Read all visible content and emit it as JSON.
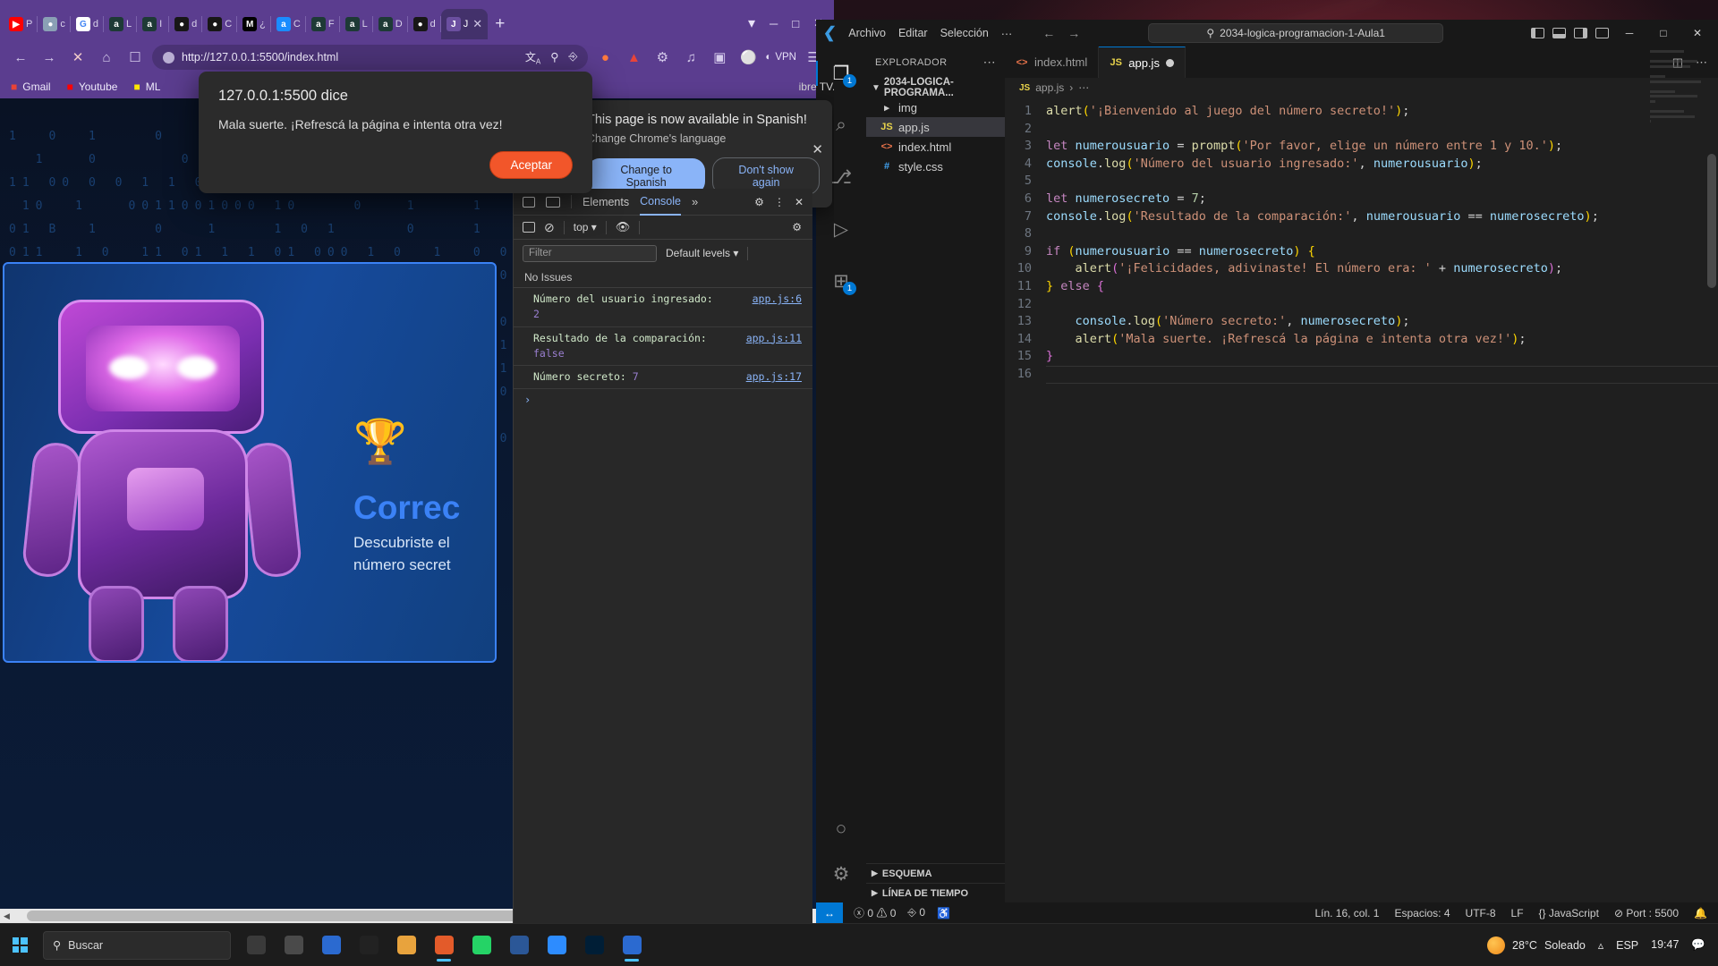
{
  "desktop": {
    "taskbar": {
      "search_placeholder": "Buscar",
      "weather_temp": "28°C",
      "weather_cond": "Soleado",
      "language": "ESP",
      "clock": "19:47",
      "start_icon": "windows-logo-icon",
      "apps": [
        {
          "name": "task-view-icon",
          "color": "#3a3a3a"
        },
        {
          "name": "settings-icon",
          "color": "#4a4a4a"
        },
        {
          "name": "store-icon",
          "color": "#2b6ad0"
        },
        {
          "name": "terminal-icon",
          "color": "#222"
        },
        {
          "name": "explorer-icon",
          "color": "#e8a33d"
        },
        {
          "name": "firefox-icon",
          "color": "#e35b2a"
        },
        {
          "name": "whatsapp-icon",
          "color": "#25d366"
        },
        {
          "name": "word-icon",
          "color": "#2b5797"
        },
        {
          "name": "zoom-icon",
          "color": "#2d8cff"
        },
        {
          "name": "photoshop-icon",
          "color": "#001e36"
        },
        {
          "name": "vscode-icon",
          "color": "#2b6ad0"
        }
      ]
    }
  },
  "chrome": {
    "tabs": [
      {
        "label": "P",
        "fav": "youtube-icon",
        "color": "#ff0000",
        "glyph": "▶",
        "active": false
      },
      {
        "label": "c",
        "fav": "globe-icon",
        "color": "#8aa0b5",
        "glyph": "●",
        "active": false
      },
      {
        "label": "d",
        "fav": "google-icon",
        "color": "#ffffff",
        "glyph": "G",
        "active": false
      },
      {
        "label": "L",
        "fav": "alura-icon",
        "color": "#1e3a36",
        "glyph": "a",
        "active": false
      },
      {
        "label": "I",
        "fav": "alura-icon",
        "color": "#1e3a36",
        "glyph": "a",
        "active": false
      },
      {
        "label": "d",
        "fav": "github-icon",
        "color": "#181717",
        "glyph": "●",
        "active": false
      },
      {
        "label": "C",
        "fav": "github-icon",
        "color": "#181717",
        "glyph": "●",
        "active": false
      },
      {
        "label": "¿",
        "fav": "medium-icon",
        "color": "#000000",
        "glyph": "M",
        "active": false
      },
      {
        "label": "C",
        "fav": "alura-icon",
        "color": "#1a8cff",
        "glyph": "a",
        "active": false
      },
      {
        "label": "F",
        "fav": "alura-icon",
        "color": "#1e3a36",
        "glyph": "a",
        "active": false
      },
      {
        "label": "L",
        "fav": "alura-icon",
        "color": "#1e3a36",
        "glyph": "a",
        "active": false
      },
      {
        "label": "D",
        "fav": "alura-icon",
        "color": "#1e3a36",
        "glyph": "a",
        "active": false
      },
      {
        "label": "d",
        "fav": "github-icon",
        "color": "#181717",
        "glyph": "●",
        "active": false
      },
      {
        "label": "J",
        "fav": "js-icon",
        "color": "#6b4fa0",
        "glyph": "J",
        "active": true
      }
    ],
    "new_tab_label": "+",
    "window_controls": {
      "minimize": "─",
      "maximize": "□",
      "close": "✕"
    },
    "toolbar": {
      "back": "←",
      "forward": "→",
      "reload": "✕",
      "home": "⌂",
      "bookmark": "☐",
      "url": "http://127.0.0.1:5500/index.html",
      "translate_icon": "translate-icon",
      "search_icon": "search-icon",
      "share_icon": "share-icon",
      "shield_icon": "shield-icon",
      "adblock_icon": "adblock-icon",
      "extensions_icon": "extensions-icon",
      "media_icon": "media-icon",
      "split_icon": "split-icon",
      "vpn_label": "VPN",
      "menu_icon": "menu-icon"
    },
    "bookmarks": [
      {
        "label": "Gmail",
        "icon": "gmail-icon",
        "color": "#ea4335"
      },
      {
        "label": "Youtube",
        "icon": "youtube-icon",
        "color": "#ff0000"
      },
      {
        "label": "ML",
        "icon": "mercadolibre-icon",
        "color": "#ffe600"
      }
    ],
    "bookmarks_overflow": "»"
  },
  "translate_bubble": {
    "title": "This page is now available in Spanish!",
    "subtitle": "Change Chrome's language",
    "primary_button": "Change to Spanish",
    "secondary_button": "Don't show again",
    "close_icon": "close-icon",
    "partial_tab_text": "ibre TV..."
  },
  "js_alert": {
    "title": "127.0.0.1:5500 dice",
    "message": "Mala suerte. ¡Refrescá la página e intenta otra vez!",
    "ok_button": "Aceptar"
  },
  "page": {
    "heading": "Correc",
    "subtext": "Descubriste el\nnúmero secret",
    "trophy_icon": "trophy-icon",
    "robot_icon": "robot-mascot-icon",
    "binary_text": "1  0  1    0   1   0  1   0    0  1   0\n  1   0      0    1   0       1    0   1\n11 00 0 0 1 1 0 1 1 0 1 0 1 1 0 1 0 0 0 0 1\n 10  1   0011001000 10    0   1    1   0\n01 B  1    0   1    1 0 1     0    1   0\n011  1 0  11 01 1 1 01 000 1 0  1  0 0 1\n0000 1 1 0 1  1  0 1 1 0 1 1 0 0 1 1 0 1\n0001 0  1    0 11 1 1    1  0   1   0  1\n01111  0  1   1 0 11111   0 1 0 0 1  0\n1  1100  1 0  1 0 1 1 0 00 1 0 1 1 0 1 0\n011 0 1 0   1 0 11 0 1 0 10 1  0 1 0 1 1\n01101 1 0 1 0 011  0 1 1 0 1 1  11  100\n0110  1 01 1 0 0 1  0 1 1 0 1 1 0  1  0\n011 0 1 1 0 1  1 0  0 0  1 0 1 1 0 1 0 1\n1011  1 1 11 0 1   11011  1 0 1 1  0  1\n010 11 011010 101101 01 010 0   0  1  0\n  1     1       0      1        1     0\n     1      0        1      0      1"
  },
  "devtools": {
    "tabs": [
      {
        "label": "Elements",
        "active": false
      },
      {
        "label": "Console",
        "active": true
      }
    ],
    "overflow": "»",
    "inspect_icon": "inspect-element-icon",
    "device_icon": "device-toolbar-icon",
    "settings_icon": "gear-icon",
    "more_icon": "more-vertical-icon",
    "close_icon": "close-icon",
    "sidebar_icon": "console-sidebar-icon",
    "clear_icon": "clear-console-icon",
    "context": "top",
    "eye_icon": "live-expression-icon",
    "filter_placeholder": "Filter",
    "levels_label": "Default levels",
    "issues_label": "No Issues",
    "messages": [
      {
        "text": "Número del usuario ingresado:",
        "value": "2",
        "value_type": "num",
        "source": "app.js:6",
        "inline": false
      },
      {
        "text": "Resultado de la comparación:",
        "value": "false",
        "value_type": "bool",
        "source": "app.js:11",
        "inline": false
      },
      {
        "text": "Número secreto:",
        "value": "7",
        "value_type": "num",
        "source": "app.js:17",
        "inline": true
      }
    ],
    "prompt": "›"
  },
  "vscode": {
    "title_bar": {
      "logo": "vscode-logo-icon",
      "menus": [
        "Archivo",
        "Editar",
        "Selección"
      ],
      "menu_overflow": "⋯",
      "back": "←",
      "forward": "→",
      "search_value": "2034-logica-programacion-1-Aula1",
      "search_icon": "search-icon",
      "layout_icons": [
        "toggle-primary-sidebar-icon",
        "toggle-panel-icon",
        "toggle-secondary-sidebar-icon",
        "customize-layout-icon"
      ],
      "window_controls": {
        "minimize": "─",
        "maximize": "□",
        "close": "✕"
      }
    },
    "activity_bar": [
      {
        "name": "explorer-icon",
        "glyph": "❐",
        "badge": "1",
        "active": true
      },
      {
        "name": "search-icon",
        "glyph": "⌕",
        "badge": null,
        "active": false
      },
      {
        "name": "source-control-icon",
        "glyph": "⎇",
        "badge": null,
        "active": false
      },
      {
        "name": "run-debug-icon",
        "glyph": "▷",
        "badge": null,
        "active": false
      },
      {
        "name": "extensions-icon",
        "glyph": "⊞",
        "badge": "1",
        "active": false
      }
    ],
    "activity_bar_bottom": [
      {
        "name": "accounts-icon",
        "glyph": "○"
      },
      {
        "name": "manage-settings-icon",
        "glyph": "⚙"
      }
    ],
    "explorer": {
      "title": "EXPLORADOR",
      "more_icon": "more-actions-icon",
      "root_folder": "2034-LOGICA-PROGRAMA...",
      "items": [
        {
          "label": "img",
          "type": "folder",
          "icon": "folder-icon",
          "selected": false
        },
        {
          "label": "app.js",
          "type": "file",
          "icon": "js-file-icon",
          "selected": true
        },
        {
          "label": "index.html",
          "type": "file",
          "icon": "html-file-icon",
          "selected": false
        },
        {
          "label": "style.css",
          "type": "file",
          "icon": "css-file-icon",
          "selected": false
        }
      ],
      "sections": [
        {
          "label": "ESQUEMA"
        },
        {
          "label": "LÍNEA DE TIEMPO"
        }
      ]
    },
    "editor": {
      "tabs": [
        {
          "label": "index.html",
          "icon": "html-file-icon",
          "active": false,
          "dirty": false
        },
        {
          "label": "app.js",
          "icon": "js-file-icon",
          "active": true,
          "dirty": true
        }
      ],
      "tab_actions": [
        "split-editor-icon",
        "more-actions-icon"
      ],
      "breadcrumb": [
        "app.js",
        "⋯"
      ],
      "lines": [
        {
          "n": 1,
          "tokens": [
            {
              "t": "alert",
              "c": "fn"
            },
            {
              "t": "(",
              "c": "p"
            },
            {
              "t": "'¡Bienvenido al juego del número secreto!'",
              "c": "s"
            },
            {
              "t": ")",
              "c": "p"
            },
            {
              "t": ";",
              "c": "op"
            }
          ]
        },
        {
          "n": 2,
          "tokens": []
        },
        {
          "n": 3,
          "tokens": [
            {
              "t": "let ",
              "c": "k"
            },
            {
              "t": "numerousuario",
              "c": "v"
            },
            {
              "t": " = ",
              "c": "op"
            },
            {
              "t": "prompt",
              "c": "fn"
            },
            {
              "t": "(",
              "c": "p"
            },
            {
              "t": "'Por favor, elige un número entre 1 y 10.'",
              "c": "s"
            },
            {
              "t": ")",
              "c": "p"
            },
            {
              "t": ";",
              "c": "op"
            }
          ]
        },
        {
          "n": 4,
          "tokens": [
            {
              "t": "console",
              "c": "v"
            },
            {
              "t": ".",
              "c": "op"
            },
            {
              "t": "log",
              "c": "fn"
            },
            {
              "t": "(",
              "c": "p"
            },
            {
              "t": "'Número del usuario ingresado:'",
              "c": "s"
            },
            {
              "t": ", ",
              "c": "op"
            },
            {
              "t": "numerousuario",
              "c": "v"
            },
            {
              "t": ")",
              "c": "p"
            },
            {
              "t": ";",
              "c": "op"
            }
          ]
        },
        {
          "n": 5,
          "tokens": []
        },
        {
          "n": 6,
          "tokens": [
            {
              "t": "let ",
              "c": "k"
            },
            {
              "t": "numerosecreto",
              "c": "v"
            },
            {
              "t": " = ",
              "c": "op"
            },
            {
              "t": "7",
              "c": "n"
            },
            {
              "t": ";",
              "c": "op"
            }
          ]
        },
        {
          "n": 7,
          "tokens": [
            {
              "t": "console",
              "c": "v"
            },
            {
              "t": ".",
              "c": "op"
            },
            {
              "t": "log",
              "c": "fn"
            },
            {
              "t": "(",
              "c": "p"
            },
            {
              "t": "'Resultado de la comparación:'",
              "c": "s"
            },
            {
              "t": ", ",
              "c": "op"
            },
            {
              "t": "numerousuario",
              "c": "v"
            },
            {
              "t": " == ",
              "c": "op"
            },
            {
              "t": "numerosecreto",
              "c": "v"
            },
            {
              "t": ")",
              "c": "p"
            },
            {
              "t": ";",
              "c": "op"
            }
          ]
        },
        {
          "n": 8,
          "tokens": []
        },
        {
          "n": 9,
          "tokens": [
            {
              "t": "if ",
              "c": "k"
            },
            {
              "t": "(",
              "c": "p"
            },
            {
              "t": "numerousuario",
              "c": "v"
            },
            {
              "t": " == ",
              "c": "op"
            },
            {
              "t": "numerosecreto",
              "c": "v"
            },
            {
              "t": ")",
              "c": "p"
            },
            {
              "t": " ",
              "c": "op"
            },
            {
              "t": "{",
              "c": "p"
            }
          ]
        },
        {
          "n": 10,
          "tokens": [
            {
              "t": "    ",
              "c": "op"
            },
            {
              "t": "alert",
              "c": "fn"
            },
            {
              "t": "(",
              "c": "p2"
            },
            {
              "t": "'¡Felicidades, adivinaste! El número era: '",
              "c": "s"
            },
            {
              "t": " + ",
              "c": "op"
            },
            {
              "t": "numerosecreto",
              "c": "v"
            },
            {
              "t": ")",
              "c": "p2"
            },
            {
              "t": ";",
              "c": "op"
            }
          ]
        },
        {
          "n": 11,
          "tokens": [
            {
              "t": "}",
              "c": "p"
            },
            {
              "t": " else ",
              "c": "k"
            },
            {
              "t": "{",
              "c": "p2"
            }
          ]
        },
        {
          "n": 12,
          "tokens": []
        },
        {
          "n": 13,
          "tokens": [
            {
              "t": "    ",
              "c": "op"
            },
            {
              "t": "console",
              "c": "v"
            },
            {
              "t": ".",
              "c": "op"
            },
            {
              "t": "log",
              "c": "fn"
            },
            {
              "t": "(",
              "c": "p"
            },
            {
              "t": "'Número secreto:'",
              "c": "s"
            },
            {
              "t": ", ",
              "c": "op"
            },
            {
              "t": "numerosecreto",
              "c": "v"
            },
            {
              "t": ")",
              "c": "p"
            },
            {
              "t": ";",
              "c": "op"
            }
          ]
        },
        {
          "n": 14,
          "tokens": [
            {
              "t": "    ",
              "c": "op"
            },
            {
              "t": "alert",
              "c": "fn"
            },
            {
              "t": "(",
              "c": "p"
            },
            {
              "t": "'Mala suerte. ¡Refrescá la página e intenta otra vez!'",
              "c": "s"
            },
            {
              "t": ")",
              "c": "p"
            },
            {
              "t": ";",
              "c": "op"
            }
          ]
        },
        {
          "n": 15,
          "tokens": [
            {
              "t": "}",
              "c": "p2"
            }
          ]
        },
        {
          "n": 16,
          "tokens": []
        }
      ]
    },
    "status_bar": {
      "remote_icon": "remote-window-icon",
      "errors": "0",
      "warnings": "0",
      "ports": "0",
      "radio_icon": "broadcast-icon",
      "position": "Lín. 16, col. 1",
      "indent": "Espacios: 4",
      "encoding": "UTF-8",
      "eol": "LF",
      "language": "JavaScript",
      "live_server": "Port : 5500",
      "bell_icon": "notifications-icon"
    }
  }
}
